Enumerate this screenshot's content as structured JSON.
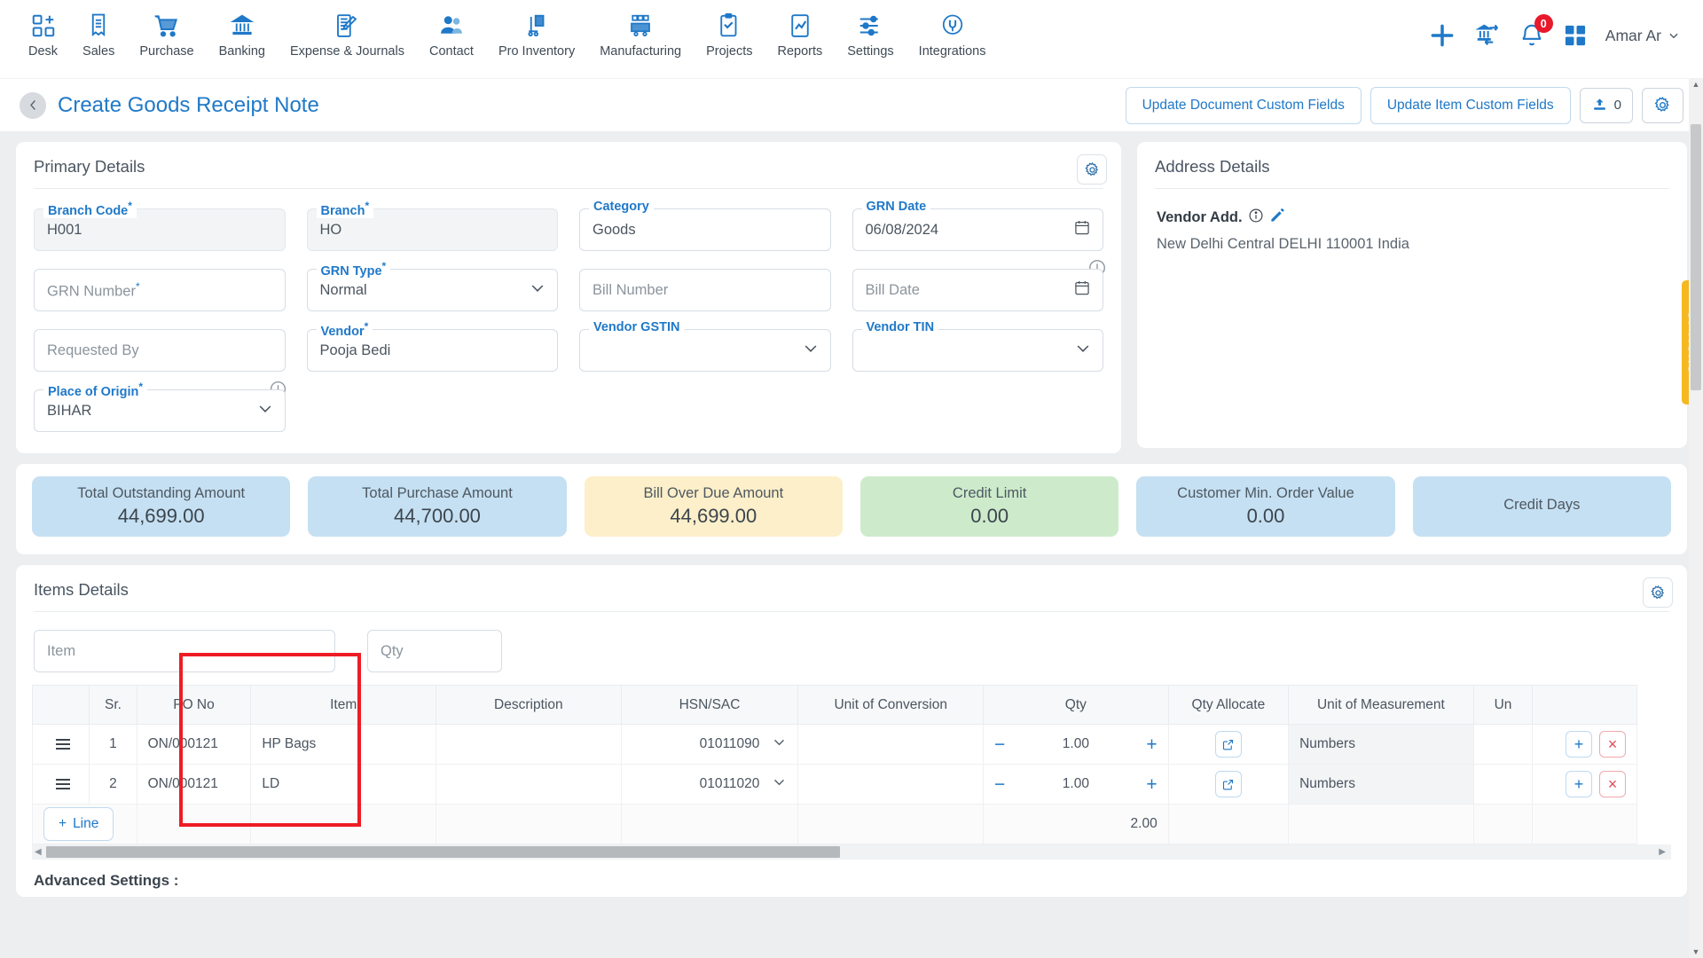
{
  "topnav": {
    "items": [
      {
        "label": "Desk",
        "icon": "desk-icon"
      },
      {
        "label": "Sales",
        "icon": "sales-receipt-icon"
      },
      {
        "label": "Purchase",
        "icon": "shopping-cart-icon"
      },
      {
        "label": "Banking",
        "icon": "bank-icon"
      },
      {
        "label": "Expense & Journals",
        "icon": "journal-icon"
      },
      {
        "label": "Contact",
        "icon": "contacts-icon"
      },
      {
        "label": "Pro Inventory",
        "icon": "inventory-icon"
      },
      {
        "label": "Manufacturing",
        "icon": "manufacturing-icon"
      },
      {
        "label": "Projects",
        "icon": "projects-clipboard-icon"
      },
      {
        "label": "Reports",
        "icon": "reports-chart-icon"
      },
      {
        "label": "Settings",
        "icon": "sliders-icon"
      },
      {
        "label": "Integrations",
        "icon": "plug-icon"
      }
    ],
    "add_icon": "plus-icon",
    "transfer_icon": "bank-transfer-icon",
    "notification_icon": "bell-icon",
    "notification_count": "0",
    "apps_icon": "grid-apps-icon",
    "user_name": "Amar Ar",
    "user_caret_icon": "chevron-down-icon"
  },
  "header": {
    "back_icon": "chevron-left-icon",
    "title": "Create Goods Receipt Note",
    "update_document_btn": "Update Document Custom Fields",
    "update_item_btn": "Update Item Custom Fields",
    "attach_icon": "upload-icon",
    "attach_count": "0",
    "settings_icon": "gear-icon"
  },
  "primary_details": {
    "title": "Primary Details",
    "gear_icon": "gear-icon",
    "fields": [
      {
        "label": "Branch Code",
        "required": true,
        "value": "H001",
        "readonly": true,
        "type": "text"
      },
      {
        "label": "Branch",
        "required": true,
        "value": "HO",
        "readonly": true,
        "type": "text"
      },
      {
        "label": "Category",
        "required": false,
        "value": "Goods",
        "readonly": false,
        "type": "text"
      },
      {
        "label": "GRN Date",
        "required": false,
        "value": "06/08/2024",
        "readonly": false,
        "type": "date"
      },
      {
        "label": "GRN Number",
        "required": true,
        "value": "",
        "placeholder": "GRN Number",
        "readonly": false,
        "type": "text"
      },
      {
        "label": "GRN Type",
        "required": true,
        "value": "Normal",
        "readonly": false,
        "type": "select"
      },
      {
        "label": "Bill Number",
        "required": false,
        "value": "",
        "placeholder": "Bill Number",
        "readonly": false,
        "type": "text"
      },
      {
        "label": "Bill Date",
        "required": false,
        "value": "",
        "placeholder": "Bill Date",
        "readonly": false,
        "type": "date",
        "warn": true
      },
      {
        "label": "Requested By",
        "required": false,
        "value": "",
        "placeholder": "Requested By",
        "readonly": false,
        "type": "text"
      },
      {
        "label": "Vendor",
        "required": true,
        "value": "Pooja Bedi",
        "readonly": false,
        "type": "text"
      },
      {
        "label": "Vendor GSTIN",
        "required": false,
        "value": "",
        "readonly": false,
        "type": "select"
      },
      {
        "label": "Vendor TIN",
        "required": false,
        "value": "",
        "readonly": false,
        "type": "select"
      },
      {
        "label": "Place of Origin",
        "required": true,
        "value": "BIHAR",
        "readonly": false,
        "type": "select",
        "warn": true
      }
    ]
  },
  "address_details": {
    "title": "Address Details",
    "vendor_label": "Vendor Add.",
    "info_icon": "info-icon",
    "edit_icon": "pencil-edit-icon",
    "address": "New Delhi Central DELHI 110001 India"
  },
  "options_tab": {
    "label": "OPTIONS",
    "color": "#f5b820"
  },
  "stats": [
    {
      "label": "Total Outstanding Amount",
      "value": "44,699.00",
      "color": "#c5e0f2"
    },
    {
      "label": "Total Purchase Amount",
      "value": "44,700.00",
      "color": "#c5e0f2"
    },
    {
      "label": "Bill Over Due Amount",
      "value": "44,699.00",
      "color": "#fcefc9"
    },
    {
      "label": "Credit Limit",
      "value": "0.00",
      "color": "#cdebcb"
    },
    {
      "label": "Customer Min. Order Value",
      "value": "0.00",
      "color": "#c5e0f2"
    },
    {
      "label": "Credit Days",
      "value": "",
      "color": "#c5e0f2"
    }
  ],
  "items_details": {
    "title": "Items Details",
    "gear_icon": "gear-icon",
    "filters": [
      {
        "placeholder": "Item",
        "name": "item-filter"
      },
      {
        "placeholder": "Qty",
        "name": "qty-filter"
      }
    ],
    "columns": [
      "",
      "Sr.",
      "PO No",
      "Item",
      "Description",
      "HSN/SAC",
      "Unit of Conversion",
      "Qty",
      "Qty Allocate",
      "Unit of Measurement",
      "Un",
      ""
    ],
    "rows": [
      {
        "handle_icon": "drag-handle-icon",
        "sr": "1",
        "po_no": "ON/000121",
        "item": "HP Bags",
        "description": "",
        "hsn_sac": "01011090",
        "unit_of_conversion": "",
        "qty": "1.00",
        "qty_allocate_icon": "external-link-icon",
        "unit_of_measurement": "Numbers",
        "un": "",
        "add_icon": "plus-icon",
        "delete_icon": "close-x-icon"
      },
      {
        "handle_icon": "drag-handle-icon",
        "sr": "2",
        "po_no": "ON/000121",
        "item": "LD",
        "description": "",
        "hsn_sac": "01011020",
        "unit_of_conversion": "",
        "qty": "1.00",
        "qty_allocate_icon": "external-link-icon",
        "unit_of_measurement": "Numbers",
        "un": "",
        "add_icon": "plus-icon",
        "delete_icon": "close-x-icon"
      }
    ],
    "add_line_label": "Line",
    "add_line_icon": "plus-icon",
    "qty_total": "2.00",
    "minus_icon": "minus-icon",
    "plus_icon": "plus-icon",
    "dropdown_icon": "chevron-down-icon"
  },
  "advanced_settings_label": "Advanced Settings :",
  "colors": {
    "accent_blue": "#2079c8",
    "highlight_red": "#ee1c25",
    "options_yellow": "#f5b820",
    "badge_red": "#e8192c"
  }
}
